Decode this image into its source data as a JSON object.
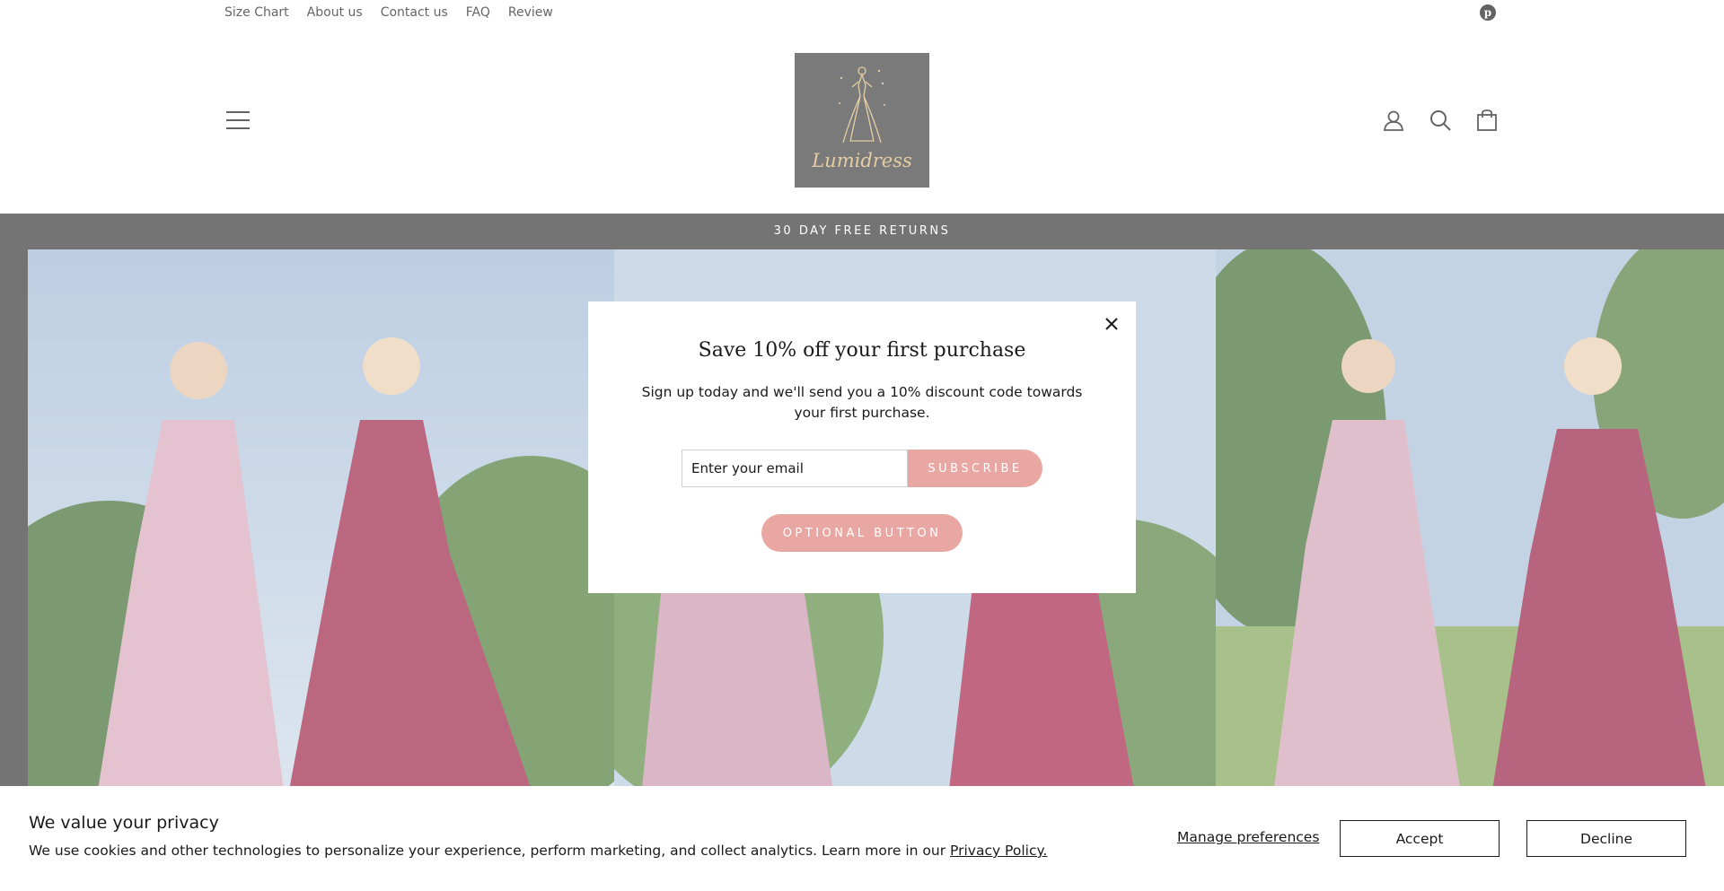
{
  "utility_nav": {
    "links": [
      "Size Chart",
      "About us",
      "Contact us",
      "FAQ",
      "Review"
    ],
    "social_icon": "pinterest-icon"
  },
  "header": {
    "logo_text": "Lumidress",
    "menu_icon": "hamburger-menu-icon",
    "account_icon": "user-icon",
    "search_icon": "search-icon",
    "cart_icon": "shopping-bag-icon"
  },
  "announcement": {
    "text": "30 DAY FREE RETURNS"
  },
  "popup": {
    "title": "Save 10% off your first purchase",
    "description": "Sign up today and we'll send you a 10% discount code towards your first purchase.",
    "email_placeholder": "Enter your email",
    "subscribe_label": "SUBSCRIBE",
    "optional_button_label": "OPTIONAL BUTTON",
    "close_icon": "close-icon"
  },
  "cookie_banner": {
    "title": "We value your privacy",
    "text": "We use cookies and other technologies to personalize your experience, perform marketing, and collect analytics. Learn more in our",
    "policy_link": "Privacy Policy.",
    "manage_label": "Manage preferences",
    "accept_label": "Accept",
    "decline_label": "Decline"
  },
  "colors": {
    "brand_pink": "#e8a7a3",
    "dark_bar": "#333333",
    "logo_gold": "#d9b77a"
  }
}
